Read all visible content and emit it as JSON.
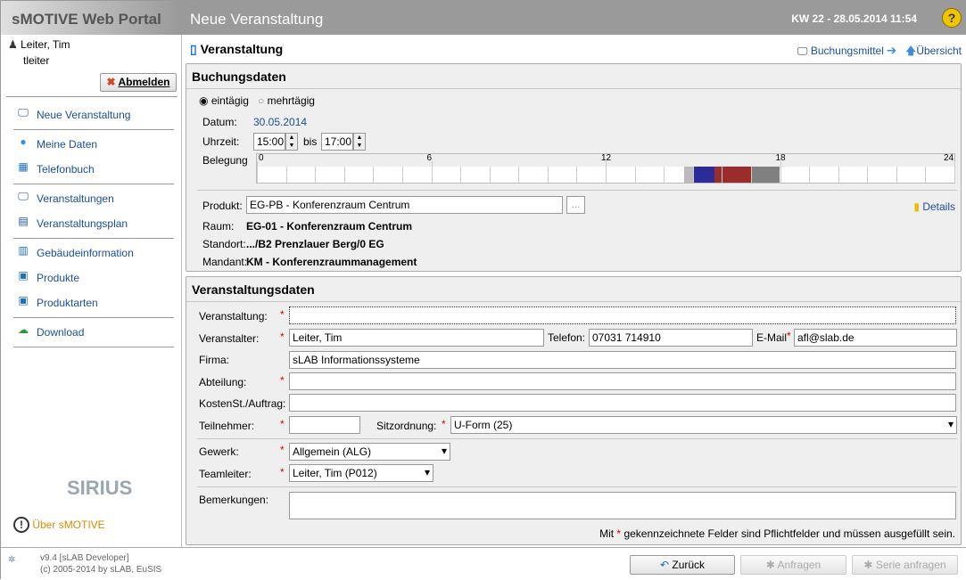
{
  "header": {
    "brand": "sMOTIVE Web Portal",
    "title": "Neue Veranstaltung",
    "kw": "KW 22 - 28.05.2014 11:54",
    "help_icon": "help-icon"
  },
  "sidebar": {
    "user_name": "Leiter, Tim",
    "user_login": "tleiter",
    "logout_label": "Abmelden",
    "items": [
      {
        "label": "Neue Veranstaltung",
        "icon": "presentation-new-icon"
      },
      {
        "label": "Meine Daten",
        "icon": "user-icon"
      },
      {
        "label": "Telefonbuch",
        "icon": "phonebook-icon"
      },
      {
        "label": "Veranstaltungen",
        "icon": "presentation-icon"
      },
      {
        "label": "Veranstaltungsplan",
        "icon": "schedule-icon"
      },
      {
        "label": "Gebäudeinformation",
        "icon": "building-icon"
      },
      {
        "label": "Produkte",
        "icon": "product-icon"
      },
      {
        "label": "Produktarten",
        "icon": "product-types-icon"
      },
      {
        "label": "Download",
        "icon": "download-icon"
      }
    ],
    "logo": "SIRIUS",
    "about_label": "Über sMOTIVE"
  },
  "main": {
    "title": "Veranstaltung",
    "link_buchungsmittel": "Buchungsmittel",
    "link_uebersicht": "Übersicht"
  },
  "buchung": {
    "title": "Buchungsdaten",
    "radio_single": "eintägig",
    "radio_multi": "mehrtägig",
    "selected": "eintägig",
    "datum_label": "Datum:",
    "datum": "30.05.2014",
    "uhrzeit_label": "Uhrzeit:",
    "von": "15:00",
    "bis_label": "bis",
    "bis": "17:00",
    "belegung_label": "Belegung",
    "ticks": [
      "0",
      "6",
      "12",
      "18",
      "24"
    ],
    "occupancy": [
      {
        "from": 14.7,
        "to": 15,
        "color": "#bbbbbb"
      },
      {
        "from": 15,
        "to": 15.75,
        "color": "#2b2b9a"
      },
      {
        "from": 15.75,
        "to": 17,
        "color": "#9b2c2c"
      },
      {
        "from": 17,
        "to": 18,
        "color": "#808080"
      }
    ],
    "produkt_label": "Produkt:",
    "produkt": "EG-PB - Konferenzraum Centrum",
    "browse": "...",
    "details": "Details",
    "raum_label": "Raum:",
    "raum": "EG-01 - Konferenzraum Centrum",
    "standort_label": "Standort:",
    "standort": ".../B2 Prenzlauer Berg/0 EG",
    "mandant_label": "Mandant:",
    "mandant": "KM - Konferenzraummanagement"
  },
  "veranstaltung": {
    "title": "Veranstaltungsdaten",
    "veranstaltung_label": "Veranstaltung:",
    "veranstaltung": "",
    "veranstalter_label": "Veranstalter:",
    "veranstalter": "Leiter, Tim",
    "telefon_label": "Telefon:",
    "telefon": "07031 714910",
    "email_label": "E-Mail",
    "email": "afl@slab.de",
    "firma_label": "Firma:",
    "firma": "sLAB Informationssysteme",
    "abteilung_label": "Abteilung:",
    "abteilung": "",
    "kosten_label": "KostenSt./Auftrag:",
    "kosten": "",
    "teilnehmer_label": "Teilnehmer:",
    "teilnehmer": "",
    "sitz_label": "Sitzordnung:",
    "sitz": "U-Form (25)",
    "gewerk_label": "Gewerk:",
    "gewerk": "Allgemein (ALG)",
    "teamleiter_label": "Teamleiter:",
    "teamleiter": "Leiter, Tim (P012)",
    "bemerkungen_label": "Bemerkungen:",
    "bemerkungen": "",
    "note_pre": "Mit",
    "note_star": "*",
    "note_post": "gekennzeichnete Felder sind Pflichtfelder und müssen ausgefüllt sein."
  },
  "footer": {
    "version": "v9.4 [sLAB Developer]",
    "copyright": "(c) 2005-2014 by sLAB, EuSIS",
    "back": "Zurück",
    "request": "Anfragen",
    "series": "Serie anfragen"
  }
}
